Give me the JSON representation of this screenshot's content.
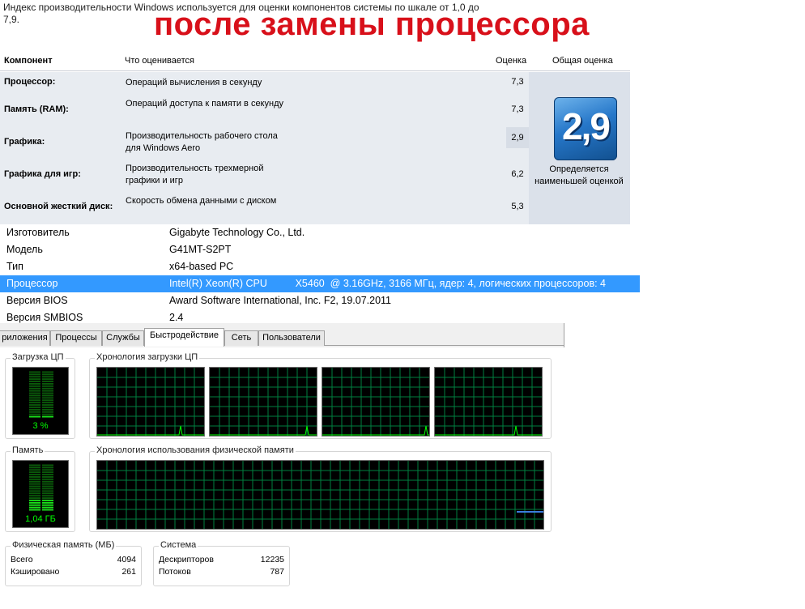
{
  "intro": "Индекс производительности Windows используется для оценки компонентов системы по шкале от 1,0 до 7,9.",
  "headline": "после замены процессора",
  "wei": {
    "headers": {
      "component": "Компонент",
      "rated": "Что оценивается",
      "score": "Оценка",
      "base": "Общая оценка"
    },
    "rows": [
      {
        "component": "Процессор:",
        "rated": "Операций вычисления в секунду",
        "score": "7,3"
      },
      {
        "component": "Память (RAM):",
        "rated": "Операций доступа к памяти в секунду",
        "score": "7,3"
      },
      {
        "component": "Графика:",
        "rated": "Производительность рабочего стола для Windows Aero",
        "score": "2,9"
      },
      {
        "component": "Графика для игр:",
        "rated": "Производительность трехмерной графики и игр",
        "score": "6,2"
      },
      {
        "component": "Основной жесткий диск:",
        "rated": "Скорость обмена данными с диском",
        "score": "5,3"
      }
    ],
    "base_score": "2,9",
    "base_caption": "Определяется наименьшей оценкой"
  },
  "system_info": [
    {
      "key": "Изготовитель",
      "value": "Gigabyte Technology Co., Ltd."
    },
    {
      "key": "Модель",
      "value": "G41MT-S2PT"
    },
    {
      "key": "Тип",
      "value": "x64-based PC"
    },
    {
      "key": "Процессор",
      "value": "Intel(R) Xeon(R) CPU          X5460  @ 3.16GHz, 3166 МГц, ядер: 4, логических процессоров: 4"
    },
    {
      "key": "Версия BIOS",
      "value": "Award Software International, Inc. F2, 19.07.2011"
    },
    {
      "key": "Версия SMBIOS",
      "value": "2.4"
    }
  ],
  "task_manager": {
    "tabs": [
      "риложения",
      "Процессы",
      "Службы",
      "Быстродействие",
      "Сеть",
      "Пользователи"
    ],
    "active_tab": "Быстродействие",
    "cpu_usage_title": "Загрузка ЦП",
    "cpu_usage_value": "3 %",
    "cpu_usage_fraction": 0.03,
    "cpu_history_title": "Хронология загрузки ЦП",
    "memory_title": "Память",
    "memory_value": "1,04 ГБ",
    "memory_fraction": 0.26,
    "memory_history_title": "Хронология использования физической памяти",
    "physical_memory": {
      "title": "Физическая память (МБ)",
      "rows": [
        {
          "label": "Всего",
          "value": "4094"
        },
        {
          "label": "Кэшировано",
          "value": "261"
        }
      ]
    },
    "system": {
      "title": "Система",
      "rows": [
        {
          "label": "Дескрипторов",
          "value": "12235"
        },
        {
          "label": "Потоков",
          "value": "787"
        }
      ]
    }
  },
  "colors": {
    "headline": "#d8101a",
    "selection": "#3399ff",
    "graph_line": "#00ff00",
    "grid": "#008040",
    "memory_line": "#3b7ddd"
  }
}
